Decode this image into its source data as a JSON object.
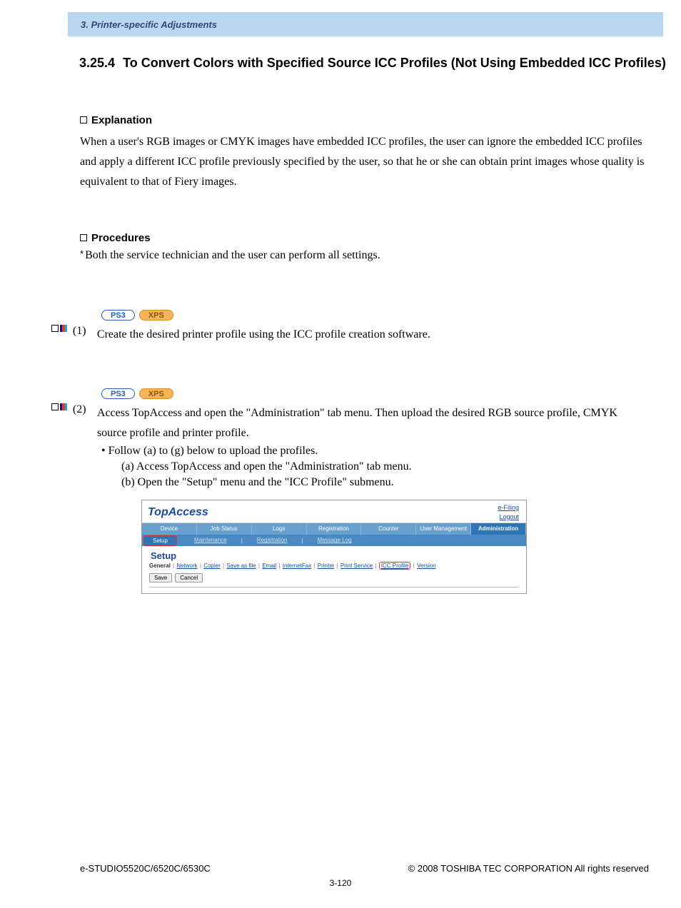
{
  "header": {
    "breadcrumb": "3. Printer-specific Adjustments"
  },
  "section": {
    "number": "3.25.4",
    "title": "To Convert Colors with Specified Source ICC Profiles (Not Using Embedded ICC Profiles)"
  },
  "explanation": {
    "heading": "Explanation",
    "body": "When a user's RGB images or CMYK images have embedded ICC profiles, the user can ignore the embedded ICC profiles and apply a different ICC profile previously specified by the user, so that he or she can obtain print images whose quality is equivalent to that of Fiery images."
  },
  "procedures": {
    "heading": "Procedures",
    "note": "Both the service technician and the user can perform all settings."
  },
  "badges": {
    "ps3": "PS3",
    "xps": "XPS"
  },
  "steps": {
    "s1": {
      "num": "(1)",
      "text": "Create the desired printer profile using the ICC profile creation software."
    },
    "s2": {
      "num": "(2)",
      "text": "Access TopAccess and open the \"Administration\" tab menu. Then upload the desired RGB source profile, CMYK source profile and printer profile.",
      "bullet": "• Follow (a) to (g) below to upload the profiles.",
      "a": "(a) Access TopAccess and open the \"Administration\" tab menu.",
      "b": "(b) Open the \"Setup\" menu and the \"ICC Profile\" submenu."
    }
  },
  "app": {
    "logo": "TopAccess",
    "links": {
      "efiling": "e-Filing",
      "logout": "Logout"
    },
    "tabs1": {
      "device": "Device",
      "jobstatus": "Job Status",
      "logs": "Logs",
      "registration": "Registration",
      "counter": "Counter",
      "usermgmt": "User Management",
      "admin": "Administration"
    },
    "tabs2": {
      "setup": "Setup",
      "maintenance": "Maintenance",
      "registration": "Registration",
      "messagelog": "Message Log"
    },
    "setup_h": "Setup",
    "subnav": {
      "general": "General",
      "network": "Network",
      "copier": "Copier",
      "saveasfile": "Save as file",
      "email": "Email",
      "internetfax": "InternetFax",
      "printer": "Printer",
      "printservice": "Print Service",
      "iccprofile": "ICC Profile",
      "version": "Version"
    },
    "buttons": {
      "save": "Save",
      "cancel": "Cancel"
    }
  },
  "footer": {
    "left": "e-STUDIO5520C/6520C/6530C",
    "right": "© 2008 TOSHIBA TEC CORPORATION All rights reserved",
    "pagenum": "3-120"
  }
}
